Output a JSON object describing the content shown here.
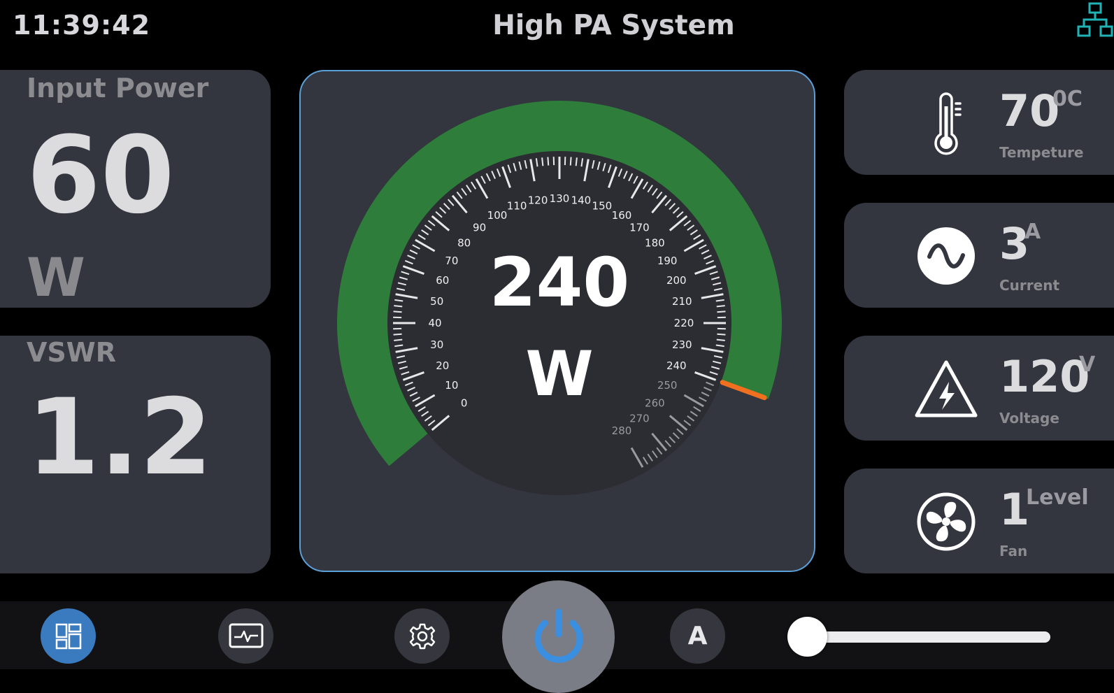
{
  "header": {
    "clock": "11:39:42",
    "title": "High PA System",
    "network_icon": "network-topology-icon",
    "network_icon_color": "#1fb3b8"
  },
  "input_power": {
    "label": "Input Power",
    "value": "60",
    "unit": "W"
  },
  "vswr": {
    "label": "VSWR",
    "value": "1.2"
  },
  "gauge": {
    "value": 240,
    "value_text": "240",
    "unit": "W",
    "min": 0,
    "max": 280,
    "tick_labels": [
      "0",
      "10",
      "20",
      "30",
      "40",
      "50",
      "60",
      "70",
      "80",
      "90",
      "100",
      "110",
      "120",
      "130",
      "140",
      "150",
      "160",
      "170",
      "180",
      "190",
      "200",
      "210",
      "220",
      "230",
      "240",
      "250",
      "260",
      "270",
      "280"
    ],
    "arc_color": "#2e7d3b",
    "needle_color": "#f07020",
    "dial_color": "#2c2c33"
  },
  "status": [
    {
      "key": "temperature",
      "icon": "thermometer-icon",
      "value": "70",
      "unit": "0C",
      "label": "Tempeture"
    },
    {
      "key": "current",
      "icon": "ac-sine-wave-icon",
      "value": "3",
      "unit": "A",
      "label": "Current"
    },
    {
      "key": "voltage",
      "icon": "high-voltage-warning-icon",
      "value": "120",
      "unit": "V",
      "label": "Voltage"
    },
    {
      "key": "fan",
      "icon": "fan-icon",
      "value": "1",
      "unit": "Level",
      "label": "Fan"
    }
  ],
  "bottom_nav": {
    "dashboard_icon": "dashboard-icon",
    "monitor_icon": "activity-monitor-icon",
    "settings_icon": "gear-icon",
    "power_icon": "power-icon",
    "mode_label": "A",
    "active_color": "#3a7bc0",
    "power_color": "#3a8fe0",
    "slider_level": 0
  }
}
